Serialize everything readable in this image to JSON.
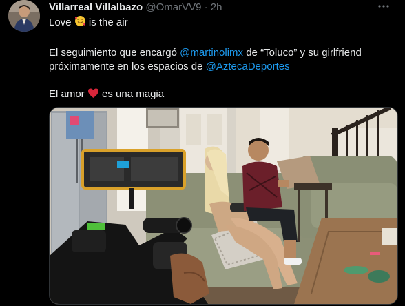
{
  "author": {
    "name": "Villarreal Villalbazo",
    "handle": "@OmarVV9",
    "separator": "·",
    "time": "2h"
  },
  "more_icon": "more-horizontal-icon",
  "text": {
    "line1_before": "Love",
    "line1_after": "is the air",
    "line2_a": "El seguimiento que encargó",
    "mention1": "@martinolimx",
    "line2_b": "de “Toluco” y su girlfriend",
    "line3_a": "próximamente en los espacios de",
    "mention2": "@AztecaDeportes",
    "line4_before": "El amor",
    "line4_after": "es una magia"
  },
  "emojis": [
    "smiling-face-with-hearts-icon",
    "red-heart-icon"
  ],
  "colors": {
    "background": "#000000",
    "text": "#e7e9ea",
    "muted": "#71767b",
    "link": "#1d9bf0"
  }
}
